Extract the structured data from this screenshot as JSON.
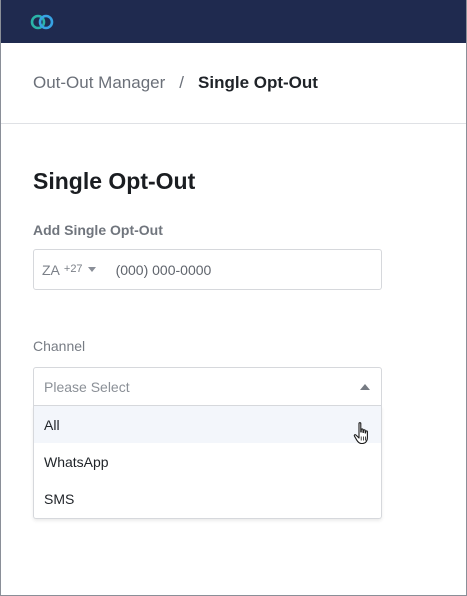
{
  "header": {
    "logo_icon": "infinity-rings-logo",
    "colors": {
      "bar": "#1f2a4f",
      "ring_teal": "#2bb3a8",
      "ring_blue": "#37a3e4"
    }
  },
  "breadcrumb": {
    "parent": "Out-Out Manager",
    "separator": "/",
    "current": "Single Opt-Out"
  },
  "page": {
    "title": "Single Opt-Out"
  },
  "phone": {
    "label": "Add Single Opt-Out",
    "country_code": "ZA",
    "dial_code": "+27",
    "placeholder": "(000) 000-0000",
    "value": ""
  },
  "channel": {
    "label": "Channel",
    "placeholder": "Please Select",
    "options": [
      "All",
      "WhatsApp",
      "SMS"
    ],
    "highlighted": "All"
  }
}
